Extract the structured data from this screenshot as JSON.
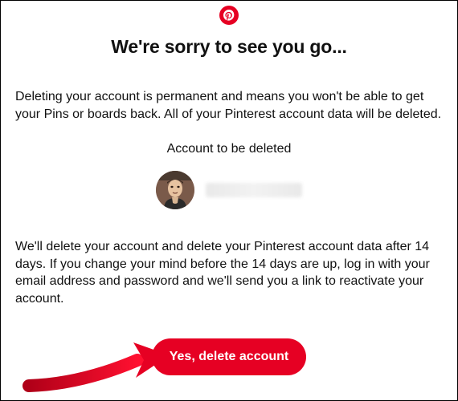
{
  "brand": {
    "color": "#e60023",
    "name": "pinterest"
  },
  "heading": "We're sorry to see you go...",
  "warning_text": "Deleting your account is permanent and means you won't be able to get your Pins or boards back. All of your Pinterest account data will be deleted.",
  "account_section": {
    "label": "Account to be deleted",
    "username": ""
  },
  "grace_period_text": "We'll delete your account and delete your Pinterest account data after 14 days. If you change your mind before the 14 days are up, log in with your email address and password and we'll send you a link to reactivate your account.",
  "confirm_button_label": "Yes, delete account"
}
